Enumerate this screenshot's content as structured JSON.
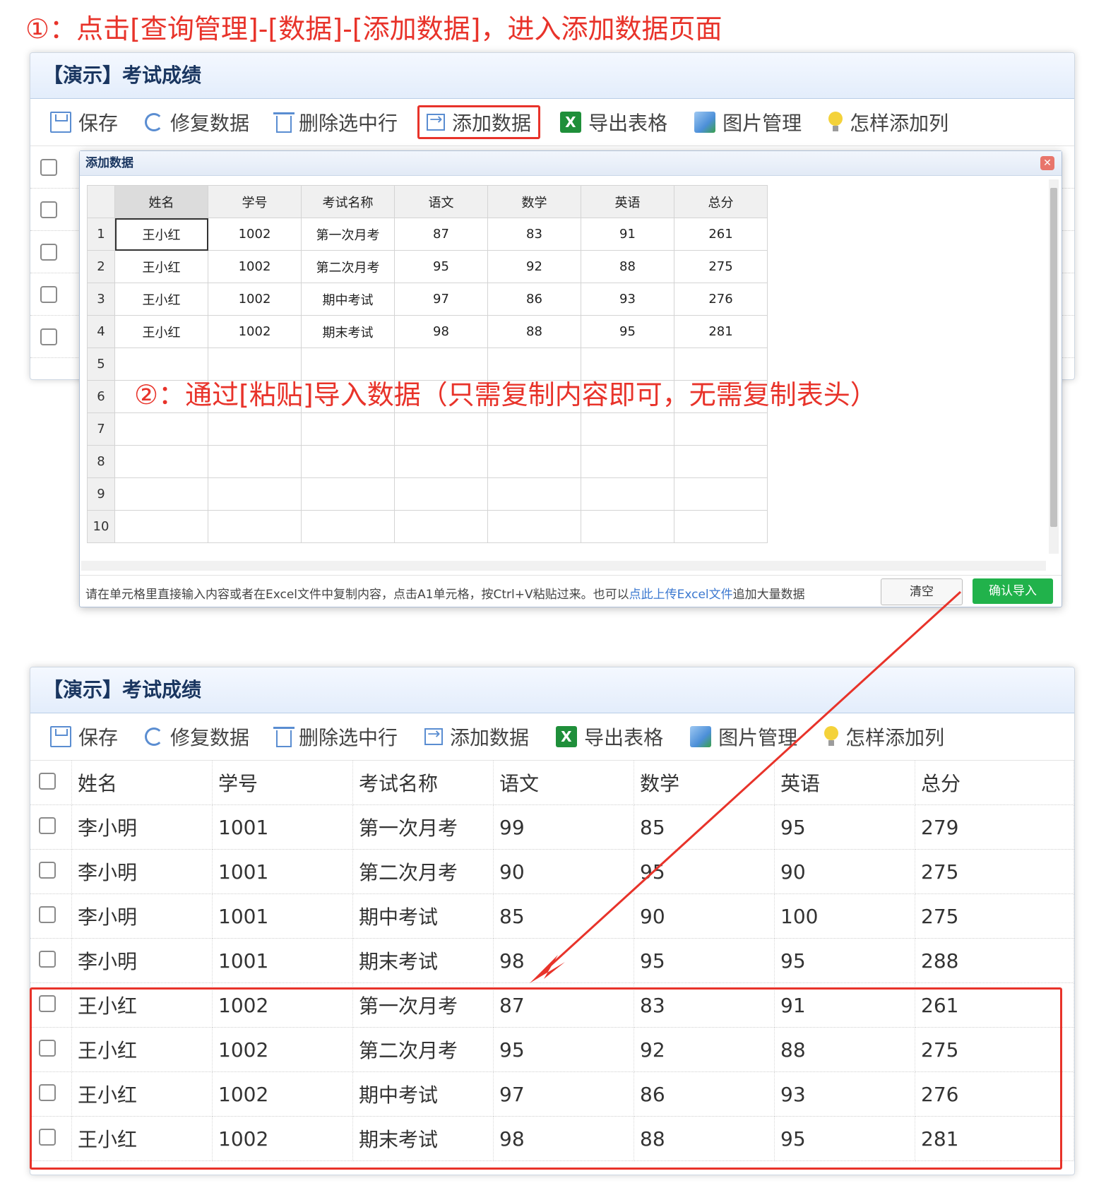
{
  "step1": "①：点击[查询管理]-[数据]-[添加数据]，进入添加数据页面",
  "step2": "②：通过[粘贴]导入数据（只需复制内容即可，无需复制表头）",
  "panel_title": "【演示】考试成绩",
  "toolbar": {
    "save": "保存",
    "repair": "修复数据",
    "delete": "删除选中行",
    "add": "添加数据",
    "export": "导出表格",
    "images": "图片管理",
    "howto": "怎样添加列"
  },
  "dialog": {
    "title": "添加数据",
    "headers": [
      "姓名",
      "学号",
      "考试名称",
      "语文",
      "数学",
      "英语",
      "总分"
    ],
    "rows": [
      {
        "n": "1",
        "c": [
          "王小红",
          "1002",
          "第一次月考",
          "87",
          "83",
          "91",
          "261"
        ]
      },
      {
        "n": "2",
        "c": [
          "王小红",
          "1002",
          "第二次月考",
          "95",
          "92",
          "88",
          "275"
        ]
      },
      {
        "n": "3",
        "c": [
          "王小红",
          "1002",
          "期中考试",
          "97",
          "86",
          "93",
          "276"
        ]
      },
      {
        "n": "4",
        "c": [
          "王小红",
          "1002",
          "期末考试",
          "98",
          "88",
          "95",
          "281"
        ]
      },
      {
        "n": "5",
        "c": [
          "",
          "",
          "",
          "",
          "",
          "",
          ""
        ]
      },
      {
        "n": "6",
        "c": [
          "",
          "",
          "",
          "",
          "",
          "",
          ""
        ]
      },
      {
        "n": "7",
        "c": [
          "",
          "",
          "",
          "",
          "",
          "",
          ""
        ]
      },
      {
        "n": "8",
        "c": [
          "",
          "",
          "",
          "",
          "",
          "",
          ""
        ]
      },
      {
        "n": "9",
        "c": [
          "",
          "",
          "",
          "",
          "",
          "",
          ""
        ]
      },
      {
        "n": "10",
        "c": [
          "",
          "",
          "",
          "",
          "",
          "",
          ""
        ]
      }
    ],
    "hint_before": "请在单元格里直接输入内容或者在Excel文件中复制内容，点击A1单元格，按Ctrl+V粘贴过来。也可以",
    "hint_link": "点此上传Excel文件",
    "hint_after": "追加大量数据",
    "clear": "清空",
    "confirm": "确认导入"
  },
  "list": {
    "headers": [
      "姓名",
      "学号",
      "考试名称",
      "语文",
      "数学",
      "英语",
      "总分"
    ],
    "rows": [
      [
        "李小明",
        "1001",
        "第一次月考",
        "99",
        "85",
        "95",
        "279"
      ],
      [
        "李小明",
        "1001",
        "第二次月考",
        "90",
        "95",
        "90",
        "275"
      ],
      [
        "李小明",
        "1001",
        "期中考试",
        "85",
        "90",
        "100",
        "275"
      ],
      [
        "李小明",
        "1001",
        "期末考试",
        "98",
        "95",
        "95",
        "288"
      ],
      [
        "王小红",
        "1002",
        "第一次月考",
        "87",
        "83",
        "91",
        "261"
      ],
      [
        "王小红",
        "1002",
        "第二次月考",
        "95",
        "92",
        "88",
        "275"
      ],
      [
        "王小红",
        "1002",
        "期中考试",
        "97",
        "86",
        "93",
        "276"
      ],
      [
        "王小红",
        "1002",
        "期末考试",
        "98",
        "88",
        "95",
        "281"
      ]
    ]
  },
  "colors": {
    "annotation": "#e8332a",
    "confirm": "#21b24b",
    "link": "#3b78d0"
  }
}
